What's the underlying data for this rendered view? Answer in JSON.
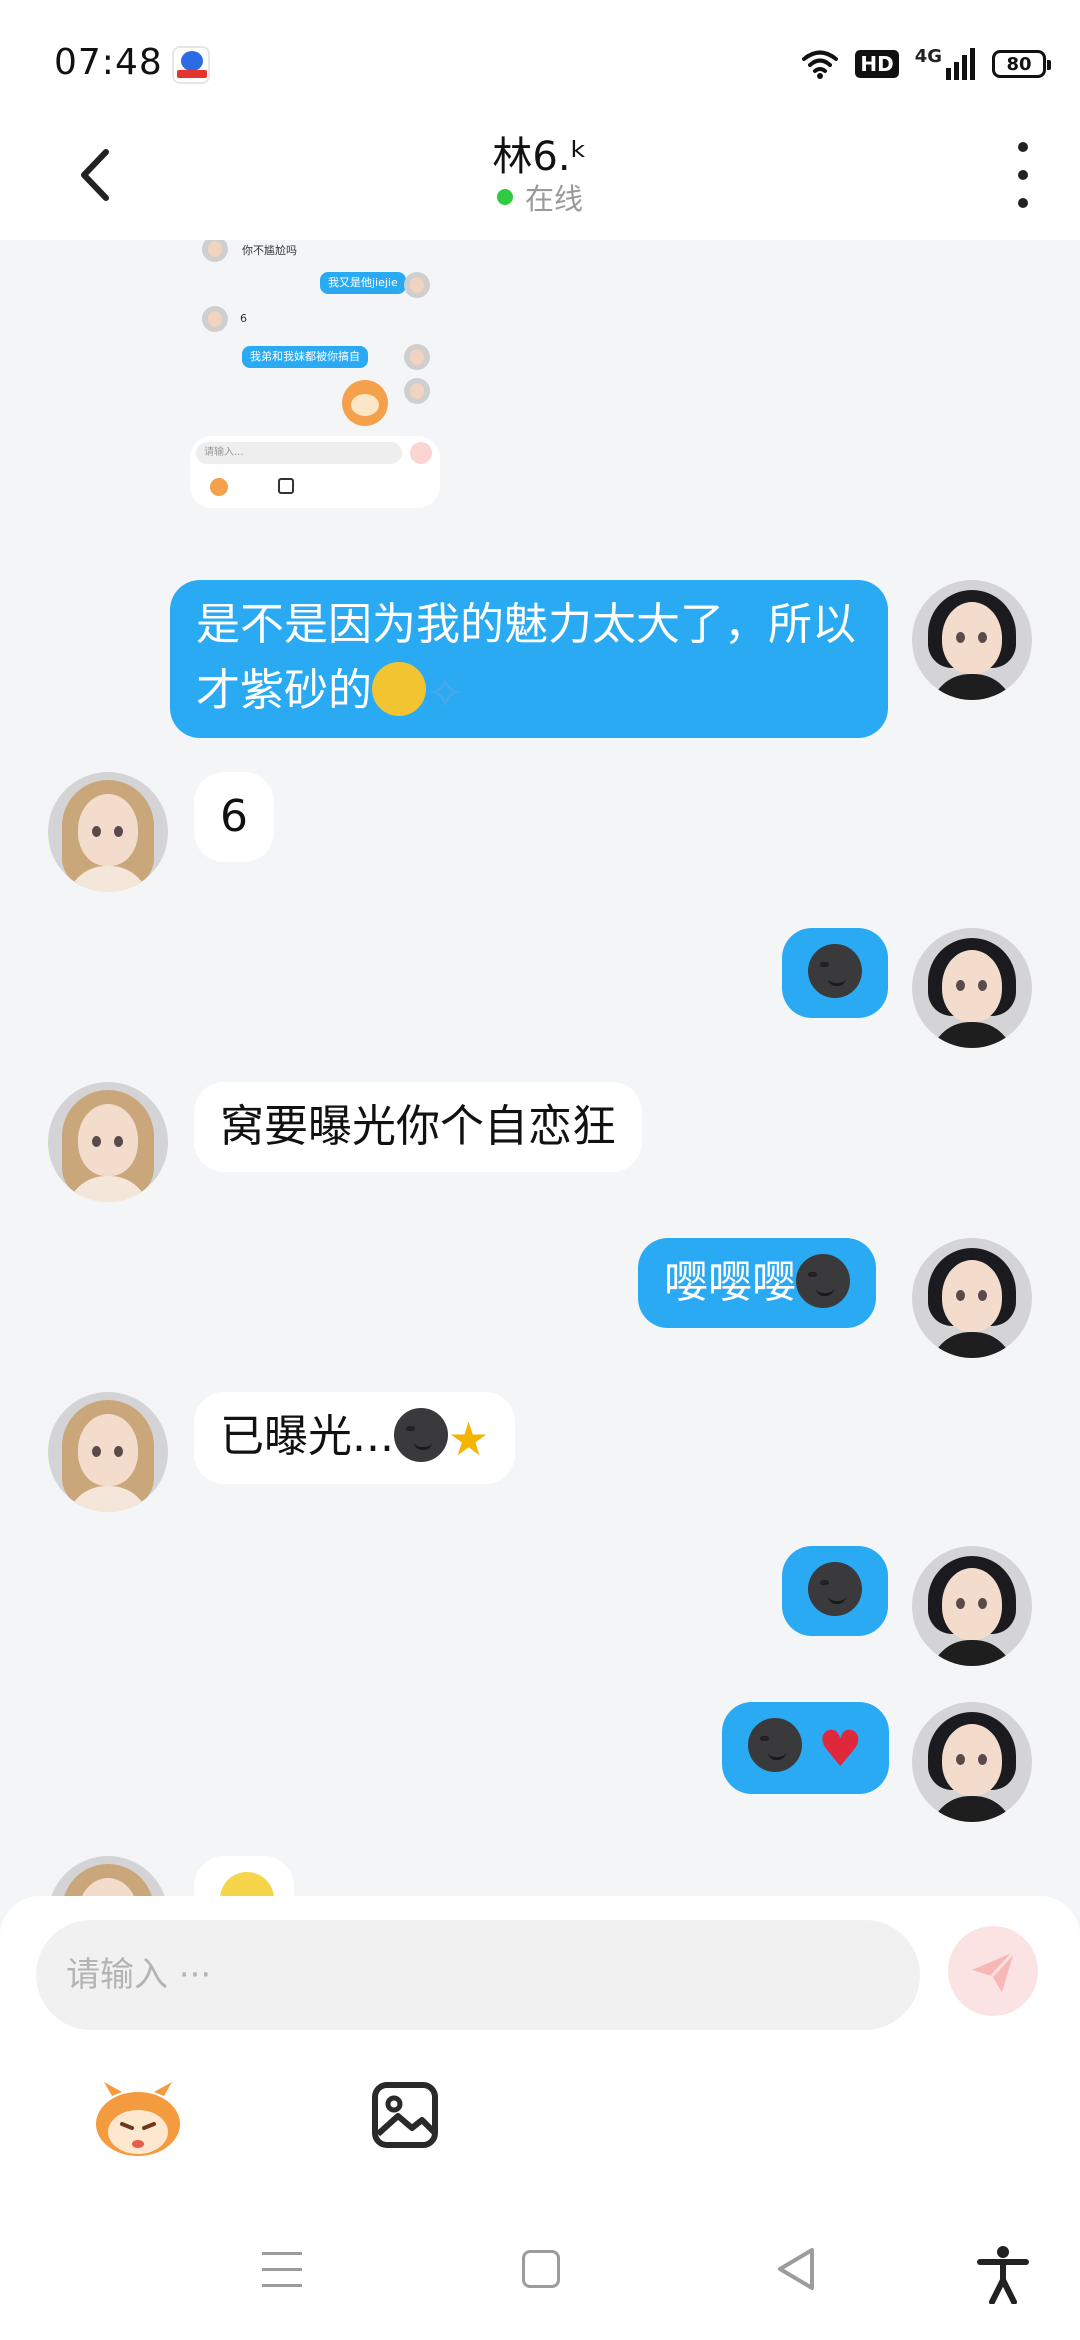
{
  "status_bar": {
    "time": "07:48",
    "hd_label": "HD",
    "network_label": "4G",
    "battery": "80",
    "icons": [
      "baidu-app-icon",
      "wifi-icon",
      "signal-icon",
      "battery-icon"
    ]
  },
  "header": {
    "title": "林6.ᵏ",
    "status": "在线",
    "status_color": "#2ecc40"
  },
  "screenshot_preview": {
    "lines": [
      "你不尴尬吗",
      "我又是他jiejie",
      "6",
      "我弟和我妹都被你搞自"
    ],
    "input_placeholder": "请输入..."
  },
  "messages": [
    {
      "sender": "me",
      "text": "是不是因为我的魅力太大了，所以才紫砂的",
      "emoji": [
        "scream-icon",
        "sweat-drops-icon"
      ]
    },
    {
      "sender": "them",
      "text": "6"
    },
    {
      "sender": "me",
      "text": "",
      "emoji": [
        "dark-moon-face-icon"
      ]
    },
    {
      "sender": "them",
      "text": "窝要曝光你个自恋狂"
    },
    {
      "sender": "me",
      "text": "嘤嘤嘤",
      "emoji": [
        "dark-moon-face-icon"
      ]
    },
    {
      "sender": "them",
      "text": "已曝光...",
      "emoji": [
        "dark-moon-face-icon",
        "dizzy-icon"
      ]
    },
    {
      "sender": "me",
      "text": "",
      "emoji": [
        "dark-moon-face-icon"
      ]
    },
    {
      "sender": "me",
      "text": "",
      "emoji": [
        "dark-moon-face-icon",
        "broken-heart-icon"
      ]
    }
  ],
  "composer": {
    "placeholder": "请输入 ···",
    "value": ""
  },
  "colors": {
    "accent": "#2aaaf2",
    "background": "#f4f5f7",
    "send_disabled": "#fce3e3"
  }
}
